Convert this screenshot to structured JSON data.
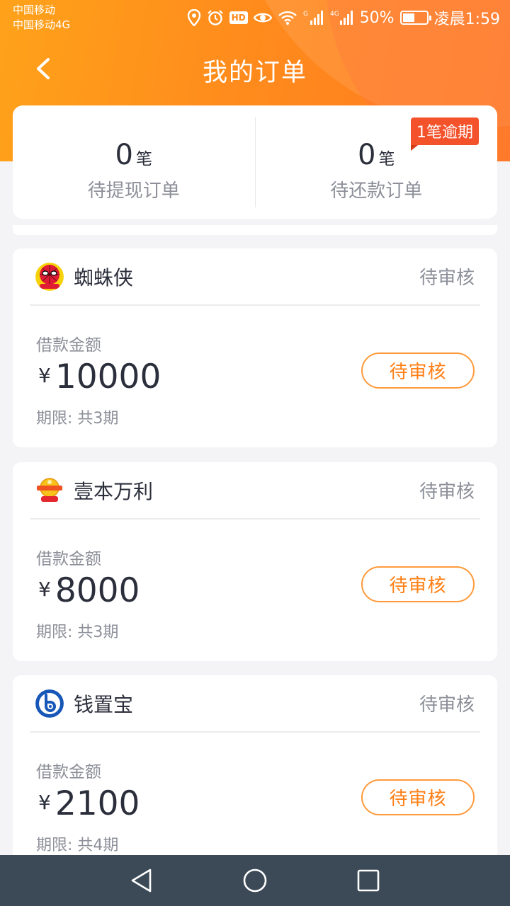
{
  "status_bar": {
    "carrier1": "中国移动",
    "carrier2": "中国移动4G",
    "hd": "HD",
    "signal1_label": "G",
    "signal2_label": "4G",
    "battery": "50%",
    "time": "凌晨1:59",
    "icons": [
      "location-icon",
      "alarm-icon",
      "hd-icon",
      "eye-icon",
      "wifi-icon",
      "signal-icon",
      "signal-4g-icon",
      "battery-icon"
    ]
  },
  "nav": {
    "title": "我的订单",
    "back_icon": "chevron-left-icon"
  },
  "summary": {
    "withdraw": {
      "count": "0",
      "unit": "笔",
      "label": "待提现订单"
    },
    "repay": {
      "count": "0",
      "unit": "笔",
      "label": "待还款订单",
      "badge": "1笔逾期"
    }
  },
  "orders": [
    {
      "lender": "蜘蛛侠",
      "logo": "spiderman-logo",
      "status": "待审核",
      "amount_label": "借款金额",
      "currency": "¥",
      "amount": "10000",
      "term": "期限: 共3期",
      "button": "待审核"
    },
    {
      "lender": "壹本万利",
      "logo": "yibenwanli-logo",
      "status": "待审核",
      "amount_label": "借款金额",
      "currency": "¥",
      "amount": "8000",
      "term": "期限: 共3期",
      "button": "待审核"
    },
    {
      "lender": "钱置宝",
      "logo": "qianzhibao-logo",
      "status": "待审核",
      "amount_label": "借款金额",
      "currency": "¥",
      "amount": "2100",
      "term": "期限: 共4期",
      "button": "待审核"
    }
  ],
  "colors": {
    "header": "#ff8c1c",
    "accent": "#ff7f15",
    "badge": "#f3522b",
    "text_primary": "#2b2e3b",
    "text_secondary": "#8d8f99",
    "system_nav": "#3c4a58"
  },
  "system_nav": {
    "icons": [
      "back-triangle-icon",
      "home-circle-icon",
      "recents-square-icon"
    ]
  }
}
